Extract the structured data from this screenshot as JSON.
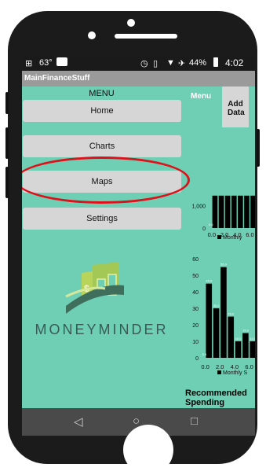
{
  "status_bar": {
    "temperature": "63°",
    "battery": "44%",
    "time": "4:02"
  },
  "app": {
    "title": "MainFinanceStuff"
  },
  "menu": {
    "title": "MENU",
    "items": [
      {
        "label": "Home"
      },
      {
        "label": "Charts"
      },
      {
        "label": "Maps"
      },
      {
        "label": "Settings"
      }
    ],
    "highlighted_item": "Maps",
    "highlight_color": "#e0101a"
  },
  "side_panel": {
    "menu_label": "Menu",
    "add_data_label": "Add Data"
  },
  "brand": {
    "name": "MONEYMINDER"
  },
  "recommended": {
    "title": "Recommended Spending"
  },
  "nav": {
    "icons": [
      "back-icon",
      "home-icon",
      "recents-icon"
    ]
  },
  "colors": {
    "screen_bg": "#6ecfb4",
    "button_bg": "#d6d6d6",
    "title_bar": "#9a9a9a",
    "bar_fill": "#000000",
    "brand_text": "#3a5a58"
  },
  "chart_data": [
    {
      "type": "bar",
      "title": "",
      "x_ticks": [
        "0.0",
        "2.0",
        "4.0",
        "6.0"
      ],
      "y_ticks": [
        "0",
        "1,000"
      ],
      "legend": "Monthly",
      "bars": [
        {
          "x": 0.5,
          "y": 1450
        },
        {
          "x": 1.5,
          "y": 1450
        },
        {
          "x": 2.5,
          "y": 1450
        },
        {
          "x": 3.5,
          "y": 1450
        },
        {
          "x": 4.5,
          "y": 1450
        },
        {
          "x": 5.5,
          "y": 1450
        },
        {
          "x": 6.5,
          "y": 1450
        }
      ],
      "value_labels": [
        {
          "x": 0.0,
          "y": 0,
          "text": "0.0"
        }
      ],
      "xlim": [
        -0.6,
        6.8
      ],
      "ylim": [
        0,
        1900
      ]
    },
    {
      "type": "bar",
      "title": "",
      "x_ticks": [
        "0.0",
        "2.0",
        "4.0",
        "6.0"
      ],
      "y_ticks": [
        "0",
        "10",
        "20",
        "30",
        "40",
        "50",
        "60"
      ],
      "legend": "Monthly S",
      "bars": [
        {
          "x": 0.5,
          "y": 45.0,
          "label": "45.0"
        },
        {
          "x": 1.5,
          "y": 30.0,
          "label": "30.0"
        },
        {
          "x": 2.5,
          "y": 55.0,
          "label": "55.0"
        },
        {
          "x": 3.5,
          "y": 25.0,
          "label": "25.0"
        },
        {
          "x": 4.5,
          "y": 10.0,
          "label": "10.0"
        },
        {
          "x": 5.5,
          "y": 15.0,
          "label": "15.0"
        },
        {
          "x": 6.5,
          "y": 10.0,
          "label": "10.0"
        }
      ],
      "value_labels": [
        {
          "x": 0.0,
          "y": 0,
          "text": "0.0"
        }
      ],
      "xlim": [
        -0.6,
        6.8
      ],
      "ylim": [
        0,
        62
      ]
    }
  ]
}
